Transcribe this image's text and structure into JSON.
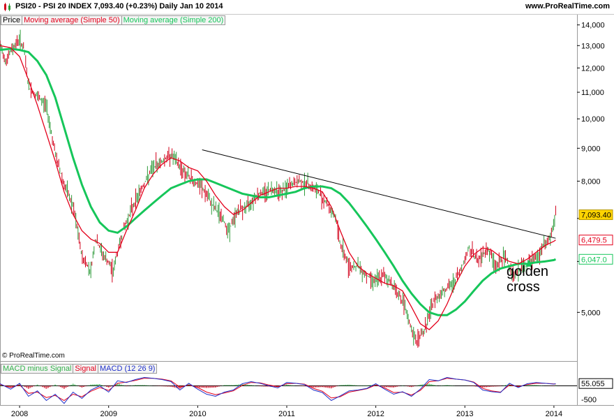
{
  "header": {
    "title": "PSI20 - PSI 20 INDEX     7,093.40 (+0.23%)     Daily  Jan 10 2014",
    "site": "www.ProRealTime.com"
  },
  "legend": {
    "price": "Price",
    "ma50": "Moving average (Simple 50)",
    "ma200": "Moving average (Simple 200)"
  },
  "macd_legend": {
    "hist": "MACD minus Signal",
    "signal": "Signal",
    "macd": "MACD (12 26 9)"
  },
  "copyright": "© ProRealTime.com",
  "annotation": {
    "line1": "golden",
    "line2": "cross"
  },
  "colors": {
    "price_up": "#2e9b3a",
    "price_down": "#d2001a",
    "ma50": "#e3001b",
    "ma200": "#16c65a",
    "trendline": "#000000",
    "last_price_bg": "#ffd400",
    "macd": "#1f30c9",
    "signal": "#e3001b",
    "hist": "#32b04a"
  },
  "chart_data": [
    {
      "type": "line",
      "scale": "log",
      "title": "PSI20 - PSI 20 INDEX",
      "ylim": [
        4200,
        14200
      ],
      "yticks": [
        5000,
        6000,
        7000,
        8000,
        9000,
        10000,
        11000,
        12000,
        13000,
        14000
      ],
      "ytick_labels": [
        "5,000",
        "",
        "",
        "8,000",
        "9,000",
        "10,000",
        "11,000",
        "12,000",
        "13,000",
        "14,000"
      ],
      "x_range": [
        2007.78,
        2014.04
      ],
      "xticks": [
        2008,
        2009,
        2010,
        2011,
        2012,
        2013,
        2014
      ],
      "xtick_labels": [
        "2008",
        "2009",
        "2010",
        "2011",
        "2012",
        "2013",
        "2014"
      ],
      "value_tags": [
        {
          "series": "Price",
          "value": 7093.4,
          "label": "7,093.40"
        },
        {
          "series": "Moving average (Simple 50)",
          "value": 6479.5,
          "label": "6,479.5"
        },
        {
          "series": "Moving average (Simple 200)",
          "value": 6047.0,
          "label": "6,047.0"
        }
      ],
      "series": [
        {
          "name": "Price",
          "x": [
            2007.78,
            2007.85,
            2007.92,
            2008.0,
            2008.05,
            2008.1,
            2008.2,
            2008.3,
            2008.4,
            2008.5,
            2008.6,
            2008.7,
            2008.8,
            2008.85,
            2008.95,
            2009.05,
            2009.15,
            2009.25,
            2009.35,
            2009.5,
            2009.6,
            2009.7,
            2009.78,
            2009.87,
            2009.95,
            2010.05,
            2010.15,
            2010.25,
            2010.35,
            2010.45,
            2010.55,
            2010.65,
            2010.75,
            2010.85,
            2010.95,
            2011.05,
            2011.15,
            2011.25,
            2011.35,
            2011.45,
            2011.55,
            2011.6,
            2011.7,
            2011.8,
            2011.9,
            2012.0,
            2012.1,
            2012.2,
            2012.3,
            2012.4,
            2012.45,
            2012.55,
            2012.65,
            2012.75,
            2012.85,
            2012.95,
            2013.05,
            2013.15,
            2013.25,
            2013.35,
            2013.45,
            2013.55,
            2013.65,
            2013.75,
            2013.85,
            2013.9,
            2013.95,
            2014.0,
            2014.02
          ],
          "values": [
            13000,
            12300,
            12900,
            13300,
            12800,
            11200,
            10800,
            10500,
            8800,
            7900,
            7300,
            6100,
            5800,
            6500,
            6100,
            5800,
            6600,
            7200,
            7700,
            8400,
            8600,
            8800,
            8500,
            8200,
            8000,
            7800,
            7400,
            7100,
            6700,
            7200,
            7300,
            7600,
            7700,
            7800,
            7700,
            7900,
            8000,
            7900,
            7700,
            7400,
            7000,
            6400,
            5900,
            5900,
            5700,
            5600,
            5700,
            5500,
            5200,
            4700,
            4500,
            4700,
            5200,
            5400,
            5500,
            5800,
            6300,
            6000,
            6300,
            5900,
            6100,
            5700,
            5900,
            6000,
            6200,
            6400,
            6500,
            6800,
            7093
          ]
        },
        {
          "name": "Moving average (Simple 50)",
          "x": [
            2007.78,
            2007.9,
            2008.0,
            2008.1,
            2008.2,
            2008.3,
            2008.4,
            2008.5,
            2008.6,
            2008.7,
            2008.8,
            2008.9,
            2009.0,
            2009.1,
            2009.2,
            2009.3,
            2009.4,
            2009.5,
            2009.6,
            2009.7,
            2009.8,
            2009.9,
            2010.0,
            2010.1,
            2010.2,
            2010.3,
            2010.4,
            2010.5,
            2010.6,
            2010.7,
            2010.8,
            2010.9,
            2011.0,
            2011.1,
            2011.2,
            2011.3,
            2011.4,
            2011.5,
            2011.6,
            2011.7,
            2011.8,
            2011.9,
            2012.0,
            2012.1,
            2012.2,
            2012.3,
            2012.4,
            2012.5,
            2012.6,
            2012.7,
            2012.8,
            2012.9,
            2013.0,
            2013.1,
            2013.2,
            2013.3,
            2013.4,
            2013.5,
            2013.6,
            2013.7,
            2013.8,
            2013.9,
            2014.0,
            2014.02
          ],
          "values": [
            13000,
            12900,
            12500,
            11500,
            10500,
            9500,
            8600,
            7700,
            7100,
            6700,
            6500,
            6400,
            6200,
            6200,
            6700,
            7200,
            7800,
            8200,
            8500,
            8700,
            8600,
            8400,
            8300,
            8000,
            7600,
            7300,
            7100,
            7200,
            7400,
            7600,
            7700,
            7800,
            7800,
            7850,
            7850,
            7800,
            7700,
            7300,
            6700,
            6200,
            5900,
            5750,
            5650,
            5550,
            5500,
            5400,
            5100,
            4800,
            4700,
            4850,
            5150,
            5550,
            5900,
            6150,
            6300,
            6250,
            6100,
            6000,
            5950,
            6050,
            6200,
            6350,
            6450,
            6479.5
          ]
        },
        {
          "name": "Moving average (Simple 200)",
          "x": [
            2007.78,
            2007.9,
            2008.0,
            2008.1,
            2008.2,
            2008.3,
            2008.4,
            2008.5,
            2008.6,
            2008.7,
            2008.8,
            2008.9,
            2009.0,
            2009.1,
            2009.2,
            2009.3,
            2009.4,
            2009.5,
            2009.6,
            2009.7,
            2009.8,
            2009.9,
            2010.0,
            2010.1,
            2010.2,
            2010.3,
            2010.4,
            2010.5,
            2010.6,
            2010.7,
            2010.8,
            2010.9,
            2011.0,
            2011.1,
            2011.2,
            2011.3,
            2011.4,
            2011.5,
            2011.6,
            2011.7,
            2011.8,
            2011.9,
            2012.0,
            2012.1,
            2012.2,
            2012.3,
            2012.4,
            2012.5,
            2012.6,
            2012.7,
            2012.8,
            2012.9,
            2013.0,
            2013.1,
            2013.2,
            2013.3,
            2013.4,
            2013.5,
            2013.6,
            2013.7,
            2013.8,
            2013.9,
            2014.0,
            2014.02
          ],
          "values": [
            12800,
            12850,
            12800,
            12700,
            12300,
            11700,
            10800,
            9700,
            8700,
            7900,
            7300,
            6900,
            6700,
            6650,
            6800,
            7000,
            7200,
            7400,
            7600,
            7800,
            7900,
            8000,
            8050,
            8050,
            7950,
            7850,
            7750,
            7650,
            7600,
            7550,
            7550,
            7600,
            7650,
            7700,
            7800,
            7850,
            7850,
            7800,
            7650,
            7400,
            7100,
            6800,
            6500,
            6200,
            5900,
            5600,
            5350,
            5150,
            5000,
            4950,
            4950,
            5050,
            5200,
            5400,
            5600,
            5750,
            5850,
            5900,
            5950,
            5950,
            5980,
            6000,
            6030,
            6047
          ]
        },
        {
          "name": "Trendline",
          "x": [
            2010.05,
            2014.02
          ],
          "values": [
            8950,
            6520
          ]
        }
      ]
    },
    {
      "type": "line",
      "title": "MACD (12 26 9)",
      "ylim": [
        -500,
        500
      ],
      "yticks": [
        -500
      ],
      "ytick_labels": [
        "-500"
      ],
      "value_tags": [
        {
          "series": "MACD (12 26 9)",
          "value": 55.055,
          "label": "55.055"
        }
      ],
      "series": [
        {
          "name": "MACD (12 26 9)",
          "x": [
            2007.78,
            2007.9,
            2008.0,
            2008.1,
            2008.2,
            2008.3,
            2008.4,
            2008.5,
            2008.6,
            2008.7,
            2008.8,
            2008.9,
            2009.0,
            2009.1,
            2009.2,
            2009.3,
            2009.4,
            2009.5,
            2009.6,
            2009.7,
            2009.8,
            2009.9,
            2010.0,
            2010.1,
            2010.2,
            2010.3,
            2010.4,
            2010.5,
            2010.6,
            2010.7,
            2010.8,
            2010.9,
            2011.0,
            2011.1,
            2011.2,
            2011.3,
            2011.4,
            2011.5,
            2011.6,
            2011.7,
            2011.8,
            2011.9,
            2012.0,
            2012.1,
            2012.2,
            2012.3,
            2012.4,
            2012.5,
            2012.6,
            2012.7,
            2012.8,
            2012.9,
            2013.0,
            2013.1,
            2013.2,
            2013.3,
            2013.4,
            2013.5,
            2013.6,
            2013.7,
            2013.8,
            2013.9,
            2014.0,
            2014.02
          ],
          "values": [
            50,
            -80,
            60,
            -250,
            -120,
            -350,
            -200,
            -420,
            -150,
            -300,
            -100,
            0,
            -150,
            120,
            80,
            150,
            200,
            180,
            150,
            100,
            -100,
            60,
            -80,
            -200,
            -250,
            -150,
            -100,
            50,
            100,
            60,
            0,
            -50,
            80,
            60,
            30,
            -100,
            -160,
            -350,
            -240,
            -120,
            -100,
            -60,
            50,
            -80,
            -200,
            -140,
            -250,
            -80,
            150,
            120,
            200,
            160,
            140,
            80,
            -100,
            -140,
            -160,
            60,
            -40,
            50,
            80,
            60,
            40,
            55
          ]
        },
        {
          "name": "Signal",
          "x": [
            2007.78,
            2007.9,
            2008.0,
            2008.1,
            2008.2,
            2008.3,
            2008.4,
            2008.5,
            2008.6,
            2008.7,
            2008.8,
            2008.9,
            2009.0,
            2009.1,
            2009.2,
            2009.3,
            2009.4,
            2009.5,
            2009.6,
            2009.7,
            2009.8,
            2009.9,
            2010.0,
            2010.1,
            2010.2,
            2010.3,
            2010.4,
            2010.5,
            2010.6,
            2010.7,
            2010.8,
            2010.9,
            2011.0,
            2011.1,
            2011.2,
            2011.3,
            2011.4,
            2011.5,
            2011.6,
            2011.7,
            2011.8,
            2011.9,
            2012.0,
            2012.1,
            2012.2,
            2012.3,
            2012.4,
            2012.5,
            2012.6,
            2012.7,
            2012.8,
            2012.9,
            2013.0,
            2013.1,
            2013.2,
            2013.3,
            2013.4,
            2013.5,
            2013.6,
            2013.7,
            2013.8,
            2013.9,
            2014.0,
            2014.02
          ],
          "values": [
            30,
            -40,
            20,
            -180,
            -150,
            -280,
            -230,
            -350,
            -200,
            -260,
            -130,
            -40,
            -110,
            60,
            90,
            130,
            180,
            180,
            160,
            120,
            -30,
            20,
            -40,
            -150,
            -210,
            -170,
            -120,
            10,
            80,
            70,
            20,
            -20,
            50,
            60,
            40,
            -60,
            -130,
            -290,
            -260,
            -150,
            -110,
            -70,
            20,
            -50,
            -160,
            -150,
            -220,
            -110,
            100,
            120,
            180,
            160,
            140,
            90,
            -60,
            -120,
            -150,
            20,
            -20,
            30,
            60,
            60,
            45,
            40
          ]
        }
      ]
    }
  ]
}
